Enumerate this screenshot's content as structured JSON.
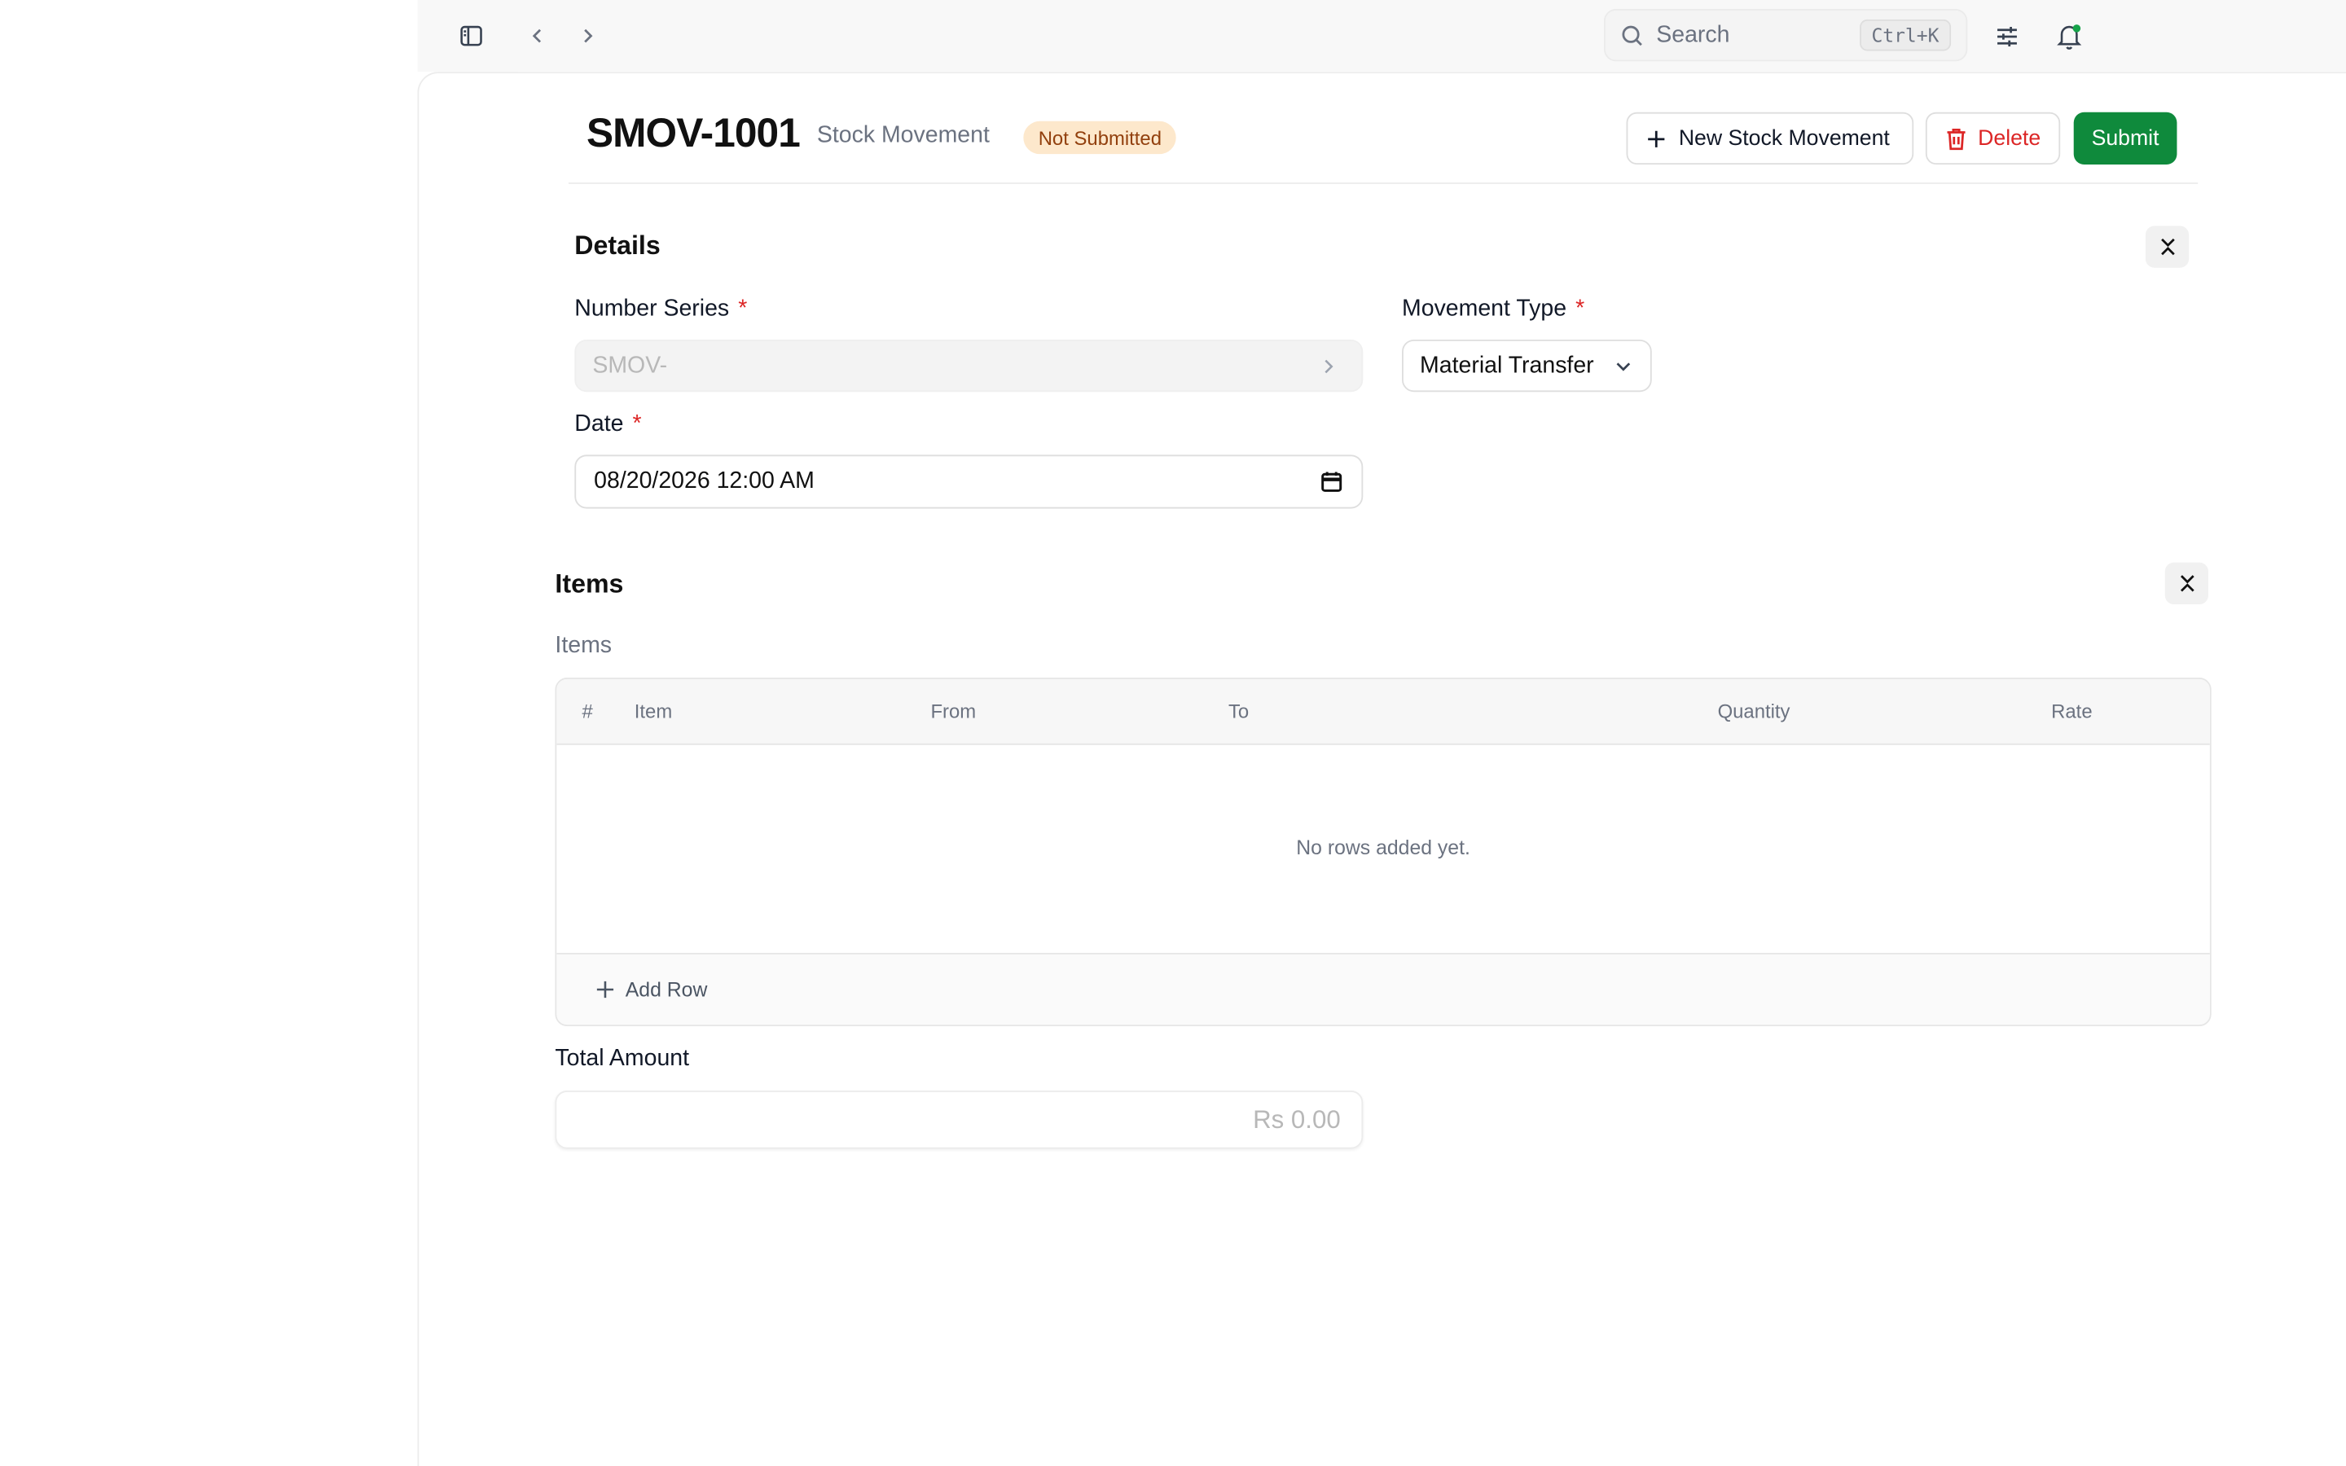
{
  "topbar": {
    "search_placeholder": "Search",
    "search_shortcut": "Ctrl+K"
  },
  "header": {
    "doc_id": "SMOV-1001",
    "doc_type": "Stock Movement",
    "status": "Not Submitted",
    "new_button": "New Stock Movement",
    "delete_button": "Delete",
    "submit_button": "Submit"
  },
  "details": {
    "title": "Details",
    "number_series": {
      "label": "Number Series",
      "required": "*",
      "value": "SMOV-"
    },
    "movement_type": {
      "label": "Movement Type",
      "required": "*",
      "value": "Material Transfer"
    },
    "date": {
      "label": "Date",
      "required": "*",
      "value": "08/20/2026 12:00 AM"
    }
  },
  "items": {
    "title": "Items",
    "table_label": "Items",
    "columns": [
      "#",
      "Item",
      "From",
      "To",
      "Quantity",
      "Rate"
    ],
    "empty_message": "No rows added yet.",
    "add_row": "Add Row"
  },
  "total": {
    "label": "Total Amount",
    "placeholder": "Rs 0.00"
  },
  "colors": {
    "submit": "#0f8a3c",
    "delete": "#dc2626",
    "badge_bg": "#fde8cc",
    "badge_text": "#92400e"
  }
}
